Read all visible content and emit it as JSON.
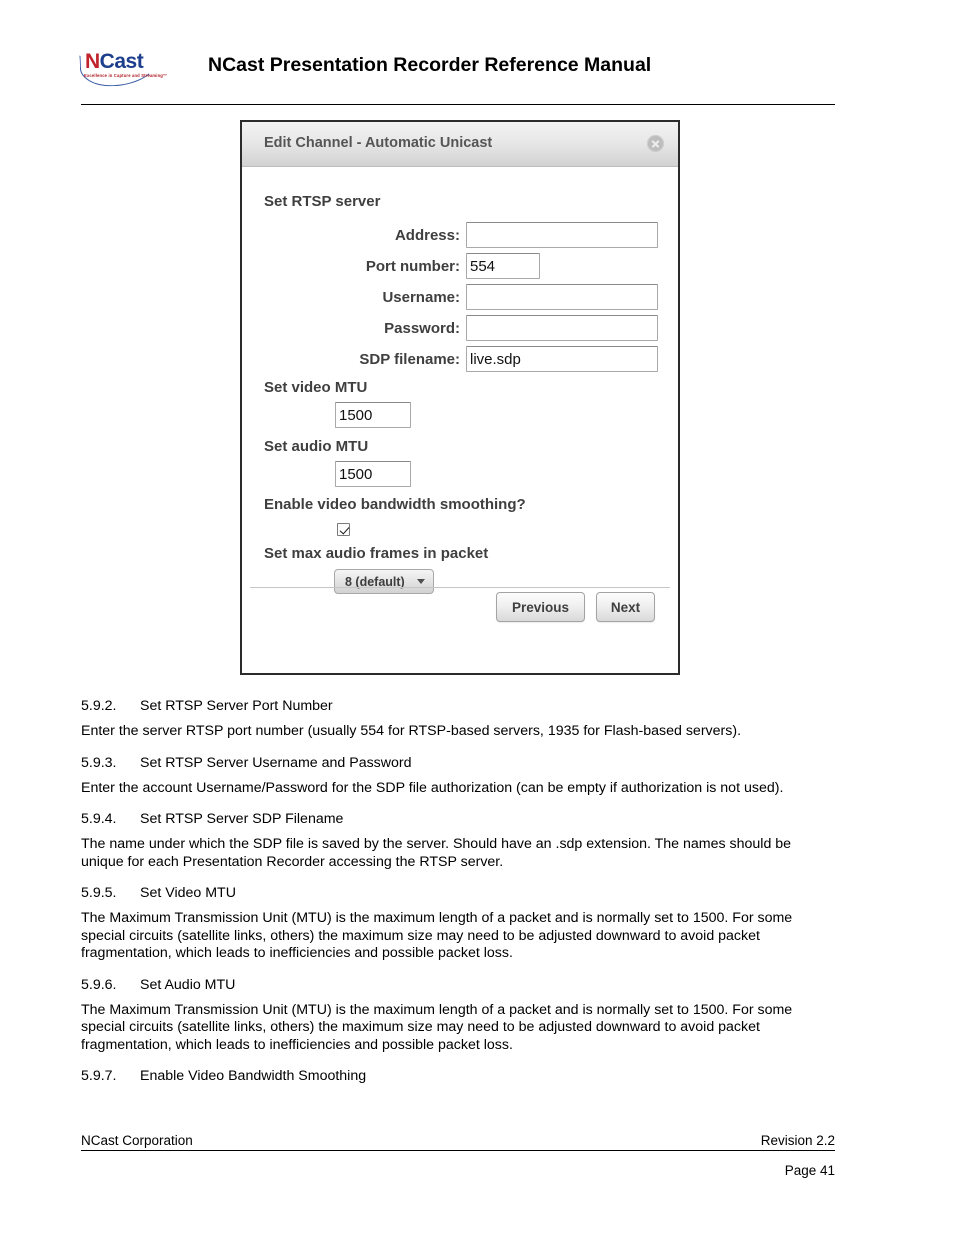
{
  "header": {
    "logo": {
      "n": "N",
      "cast": "Cast",
      "tagline": "Excellence in Capture and Streaming™"
    },
    "title": "NCast Presentation Recorder Reference Manual"
  },
  "dialog": {
    "title": "Edit Channel - Automatic Unicast",
    "close_icon": "close-circle-icon",
    "sections": {
      "rtsp_server": "Set RTSP server",
      "video_mtu": "Set video MTU",
      "audio_mtu": "Set audio MTU",
      "smoothing": "Enable video bandwidth smoothing?",
      "max_audio_frames": "Set max audio frames in packet"
    },
    "fields": {
      "address": {
        "label": "Address:",
        "value": "",
        "placeholder": ""
      },
      "port_number": {
        "label": "Port number:",
        "value": "554",
        "placeholder": ""
      },
      "username": {
        "label": "Username:",
        "value": "",
        "placeholder": ""
      },
      "password": {
        "label": "Password:",
        "value": "",
        "placeholder": ""
      },
      "sdp_filename": {
        "label": "SDP filename:",
        "value": "live.sdp",
        "placeholder": ""
      },
      "video_mtu": {
        "value": "1500"
      },
      "audio_mtu": {
        "value": "1500"
      },
      "smoothing_checked": true,
      "max_audio_frames_selected": "8 (default)"
    },
    "buttons": {
      "previous": "Previous",
      "next": "Next"
    }
  },
  "content": {
    "blocks": [
      {
        "type": "heading",
        "num": "5.9.2.",
        "text": "Set RTSP Server Port Number"
      },
      {
        "type": "para",
        "text": "Enter the server RTSP port number (usually 554 for RTSP-based servers, 1935 for Flash-based servers)."
      },
      {
        "type": "heading",
        "num": "5.9.3.",
        "text": "Set RTSP Server Username and Password"
      },
      {
        "type": "para",
        "text": "Enter the account Username/Password for the SDP file authorization (can be empty if authorization is not used)."
      },
      {
        "type": "heading",
        "num": "5.9.4.",
        "text": "Set RTSP Server SDP Filename"
      },
      {
        "type": "para",
        "text": "The name under which the SDP file is saved by the server. Should have an .sdp extension. The names should be unique for each Presentation Recorder accessing the RTSP server."
      },
      {
        "type": "heading",
        "num": "5.9.5.",
        "text": "Set Video MTU"
      },
      {
        "type": "para",
        "text": "The Maximum Transmission Unit (MTU) is the maximum length of a packet and is normally set to 1500. For some special circuits (satellite links, others) the maximum size may need to be adjusted downward to avoid packet fragmentation, which leads to inefficiencies and possible packet loss."
      },
      {
        "type": "heading",
        "num": "5.9.6.",
        "text": "Set Audio MTU"
      },
      {
        "type": "para",
        "text": "The Maximum Transmission Unit (MTU) is the maximum length of a packet and is normally set to 1500. For some special circuits (satellite links, others) the maximum size may need to be adjusted downward to avoid packet fragmentation, which leads to inefficiencies and possible packet loss."
      },
      {
        "type": "heading",
        "num": "5.9.7.",
        "text": "Enable Video Bandwidth Smoothing"
      }
    ]
  },
  "footer": {
    "left": "NCast Corporation",
    "right": "Revision 2.2",
    "page": "Page 41"
  }
}
